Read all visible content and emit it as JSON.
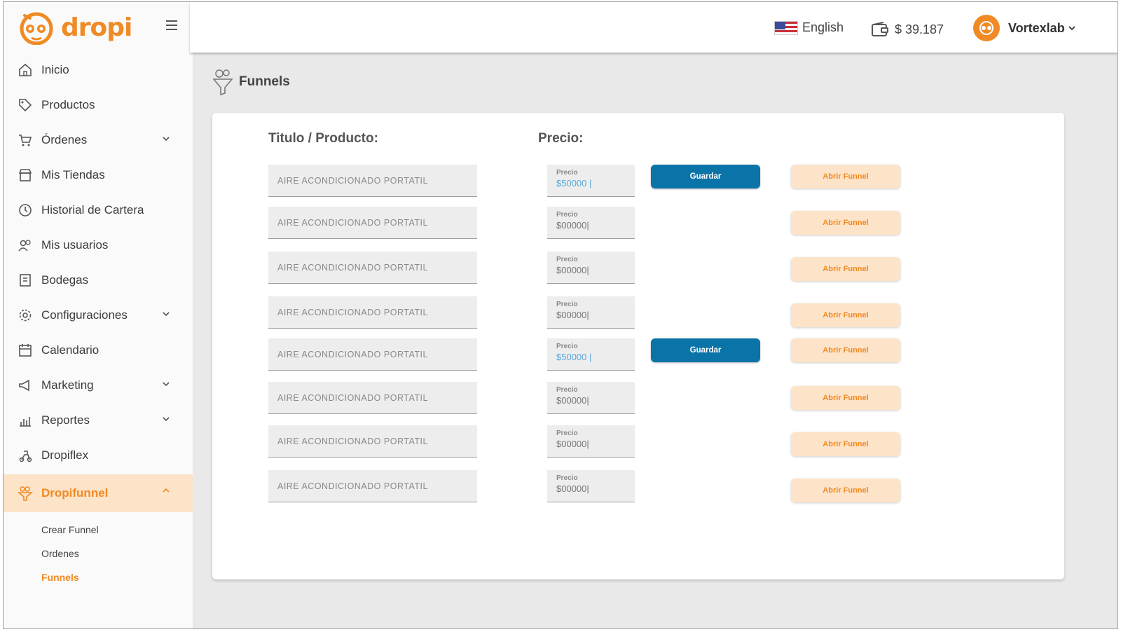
{
  "brand": {
    "name": "dropi"
  },
  "sidebar": {
    "items": [
      {
        "label": "Inicio",
        "icon": "home-icon"
      },
      {
        "label": "Productos",
        "icon": "tag-icon"
      },
      {
        "label": "Órdenes",
        "icon": "cart-icon",
        "expandable": true
      },
      {
        "label": "Mis Tiendas",
        "icon": "store-icon"
      },
      {
        "label": "Historial de Cartera",
        "icon": "history-icon"
      },
      {
        "label": "Mis usuarios",
        "icon": "users-icon"
      },
      {
        "label": "Bodegas",
        "icon": "warehouse-icon"
      },
      {
        "label": "Configuraciones",
        "icon": "gear-icon",
        "expandable": true
      },
      {
        "label": "Calendario",
        "icon": "calendar-icon"
      },
      {
        "label": "Marketing",
        "icon": "megaphone-icon",
        "expandable": true
      },
      {
        "label": "Reportes",
        "icon": "bar-chart-icon",
        "expandable": true
      },
      {
        "label": "Dropiflex",
        "icon": "delivery-icon"
      },
      {
        "label": "Dropifunnel",
        "icon": "funnel-icon",
        "expandable": true,
        "active": true
      }
    ],
    "subitems": [
      {
        "label": "Crear Funnel"
      },
      {
        "label": "Ordenes"
      },
      {
        "label": "Funnels",
        "active": true
      }
    ]
  },
  "topbar": {
    "language": "English",
    "balance": "$ 39.187",
    "username": "Vortexlab"
  },
  "page": {
    "title": "Funnels"
  },
  "table": {
    "col_title": "Titulo / Producto:",
    "col_price": "Precio:",
    "price_label": "Precio",
    "save_label": "Guardar",
    "open_label": "Abrir Funnel",
    "rows": [
      {
        "title": "AIRE ACONDICIONADO PORTATIL",
        "price": "$50000 |",
        "editing": true
      },
      {
        "title": "AIRE ACONDICIONADO PORTATIL",
        "price": "$00000|",
        "editing": false
      },
      {
        "title": "AIRE ACONDICIONADO PORTATIL",
        "price": "$00000|",
        "editing": false
      },
      {
        "title": "AIRE ACONDICIONADO PORTATIL",
        "price": "$00000|",
        "editing": false
      },
      {
        "title": "AIRE ACONDICIONADO PORTATIL",
        "price": "$50000 |",
        "editing": true
      },
      {
        "title": "AIRE ACONDICIONADO PORTATIL",
        "price": "$00000|",
        "editing": false
      },
      {
        "title": "AIRE ACONDICIONADO PORTATIL",
        "price": "$00000|",
        "editing": false
      },
      {
        "title": "AIRE ACONDICIONADO PORTATIL",
        "price": "$00000|",
        "editing": false
      }
    ]
  },
  "colors": {
    "accent": "#f08a24",
    "accent_light": "#fde3c8",
    "primary": "#0a74a8"
  }
}
